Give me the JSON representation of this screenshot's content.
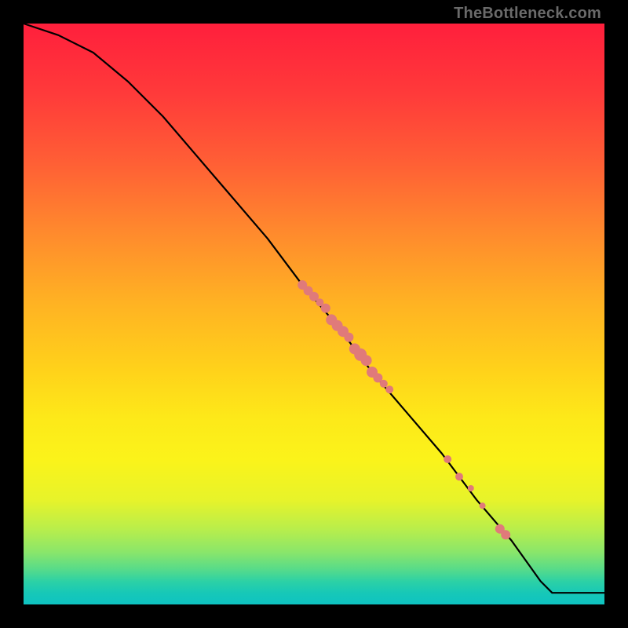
{
  "attribution": "TheBottleneck.com",
  "chart_data": {
    "type": "line",
    "title": "",
    "xlabel": "",
    "ylabel": "",
    "xlim": [
      0,
      100
    ],
    "ylim": [
      0,
      100
    ],
    "grid": false,
    "legend": false,
    "line": {
      "points": [
        {
          "x": 0,
          "y": 100
        },
        {
          "x": 6,
          "y": 98
        },
        {
          "x": 12,
          "y": 95
        },
        {
          "x": 18,
          "y": 90
        },
        {
          "x": 24,
          "y": 84
        },
        {
          "x": 30,
          "y": 77
        },
        {
          "x": 36,
          "y": 70
        },
        {
          "x": 42,
          "y": 63
        },
        {
          "x": 48,
          "y": 55
        },
        {
          "x": 54,
          "y": 48
        },
        {
          "x": 60,
          "y": 40
        },
        {
          "x": 66,
          "y": 33
        },
        {
          "x": 72,
          "y": 26
        },
        {
          "x": 78,
          "y": 18
        },
        {
          "x": 84,
          "y": 11
        },
        {
          "x": 89,
          "y": 4
        },
        {
          "x": 91,
          "y": 2
        },
        {
          "x": 100,
          "y": 2
        }
      ]
    },
    "scatter": {
      "points": [
        {
          "x": 48,
          "y": 55,
          "r": 6
        },
        {
          "x": 49,
          "y": 54,
          "r": 6
        },
        {
          "x": 50,
          "y": 53,
          "r": 6
        },
        {
          "x": 51,
          "y": 52,
          "r": 5
        },
        {
          "x": 52,
          "y": 51,
          "r": 6
        },
        {
          "x": 53,
          "y": 49,
          "r": 7
        },
        {
          "x": 54,
          "y": 48,
          "r": 7
        },
        {
          "x": 55,
          "y": 47,
          "r": 7
        },
        {
          "x": 56,
          "y": 46,
          "r": 6
        },
        {
          "x": 57,
          "y": 44,
          "r": 7
        },
        {
          "x": 58,
          "y": 43,
          "r": 8
        },
        {
          "x": 59,
          "y": 42,
          "r": 7
        },
        {
          "x": 60,
          "y": 40,
          "r": 7
        },
        {
          "x": 61,
          "y": 39,
          "r": 6
        },
        {
          "x": 62,
          "y": 38,
          "r": 5
        },
        {
          "x": 63,
          "y": 37,
          "r": 5
        },
        {
          "x": 73,
          "y": 25,
          "r": 5
        },
        {
          "x": 75,
          "y": 22,
          "r": 5
        },
        {
          "x": 77,
          "y": 20,
          "r": 4
        },
        {
          "x": 79,
          "y": 17,
          "r": 4
        },
        {
          "x": 82,
          "y": 13,
          "r": 6
        },
        {
          "x": 83,
          "y": 12,
          "r": 6
        }
      ],
      "color": "#e07a7a"
    }
  }
}
